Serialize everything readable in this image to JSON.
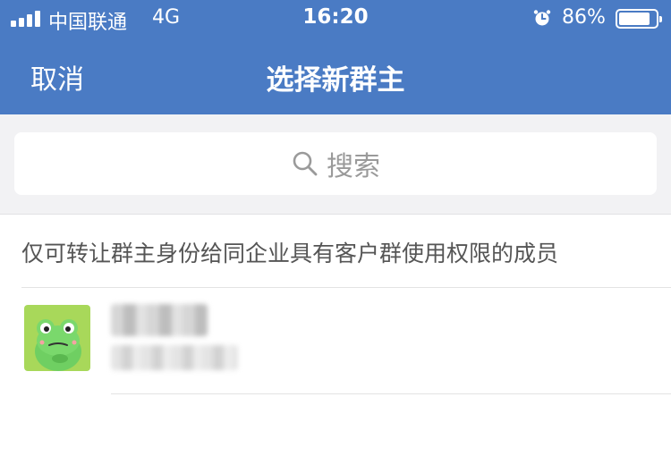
{
  "status_bar": {
    "carrier": "中国联通",
    "network": "4G",
    "time": "16:20",
    "battery_percent": "86%",
    "battery_level": 0.86,
    "icons": [
      "signal-icon",
      "alarm-icon",
      "battery-icon"
    ]
  },
  "nav": {
    "cancel_label": "取消",
    "title": "选择新群主"
  },
  "search": {
    "placeholder": "搜索",
    "icon": "search-icon"
  },
  "notice": "仅可转让群主身份给同企业具有客户群使用权限的成员",
  "members": [
    {
      "name": "",
      "subtitle": "",
      "avatar": "frog-avatar",
      "obscured": true
    }
  ],
  "colors": {
    "header_bg": "#4a7bc4",
    "search_area_bg": "#f2f2f4",
    "avatar_bg": "#a8d85a",
    "text_secondary": "#555555"
  }
}
